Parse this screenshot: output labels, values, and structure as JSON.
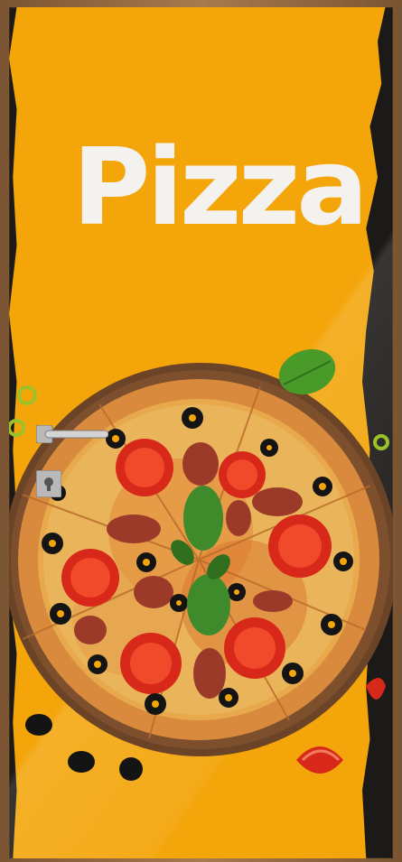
{
  "poster": {
    "title": "Pizza"
  },
  "colors": {
    "background": "#f3a50a",
    "torn_edge": "#1c1a18",
    "title": "#f4f2ee",
    "door_frame": "#8a6040"
  },
  "icons": [
    "door-handle-icon",
    "door-lock-icon",
    "pizza-illustration",
    "basil-leaf-icon",
    "olive-icon",
    "tomato-slice-icon"
  ]
}
